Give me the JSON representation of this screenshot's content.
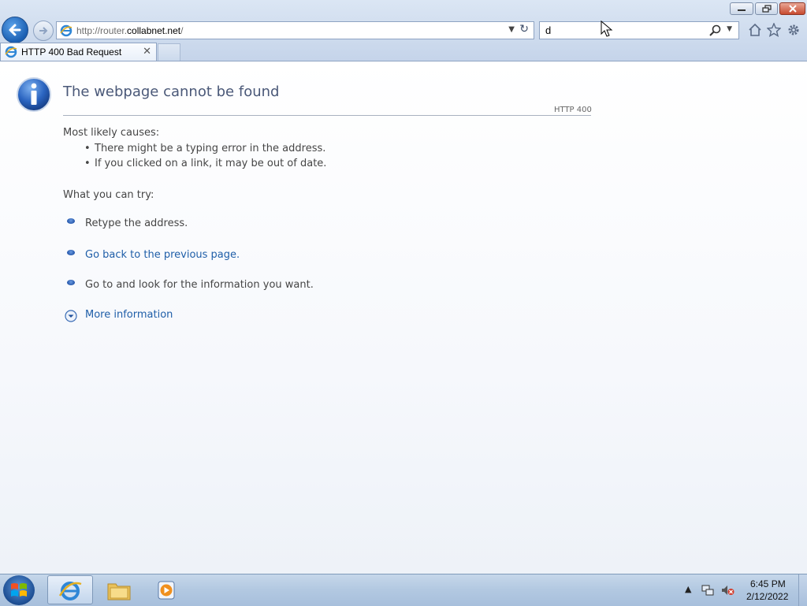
{
  "browser": {
    "address_scheme": "http://router.",
    "address_host": "collabnet.net",
    "address_path": "/",
    "search_value": "d",
    "tab_title": "HTTP 400 Bad Request"
  },
  "page": {
    "title": "The webpage cannot be found",
    "http_code": "HTTP 400",
    "causes_heading": "Most likely causes:",
    "causes": [
      "There might be a typing error in the address.",
      "If you clicked on a link, it may be out of date."
    ],
    "try_heading": "What you can try:",
    "try_items": [
      "Retype the address.",
      "Go back to the previous page.",
      "Go to  and look for the information you want."
    ],
    "more_info": "More information"
  },
  "taskbar": {
    "time": "6:45 PM",
    "date": "2/12/2022"
  },
  "colors": {
    "accent": "#1f5ea8",
    "title": "#4a5878",
    "chrome": "#cfdcee"
  }
}
